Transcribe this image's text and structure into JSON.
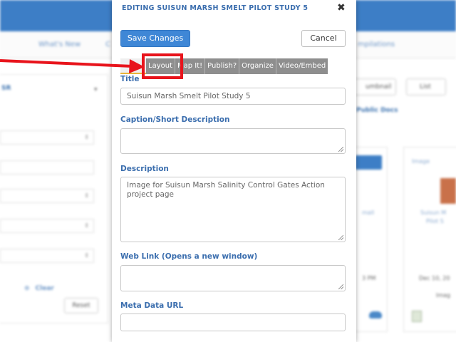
{
  "background": {
    "nav_items": [
      "What's New",
      "C",
      "mpilations"
    ],
    "left_panel_title": "SR",
    "clear_label": "Clear",
    "reset_label": "Reset",
    "view_buttons": [
      "umbnail",
      "List"
    ],
    "public_docs_label": "Public Docs",
    "card_items": [
      "Image",
      "Suisun M",
      "Pilot S",
      "Dec 10, 20",
      "Imag",
      "mall",
      "3 PM"
    ]
  },
  "modal": {
    "title": "EDITING SUISUN MARSH SMELT PILOT STUDY 5",
    "close_glyph": "✖",
    "save_label": "Save Changes",
    "cancel_label": "Cancel",
    "tabs": [
      "Layout",
      "Map It!",
      "Publish?",
      "Organize",
      "Video/Embed"
    ],
    "fields": {
      "title": {
        "label": "Title",
        "value": "Suisun Marsh Smelt Pilot Study 5"
      },
      "caption": {
        "label": "Caption/Short Description",
        "value": ""
      },
      "description": {
        "label": "Description",
        "value": "Image for Suisun Marsh Salinity Control Gates Action project page"
      },
      "web_link": {
        "label": "Web Link (Opens a new window)",
        "value": ""
      },
      "meta_data_url": {
        "label": "Meta Data URL",
        "value": ""
      }
    }
  },
  "annotation": {
    "color": "#e8141c"
  },
  "colors": {
    "accent": "#3f87d6",
    "heading": "#3b6eae",
    "tab_bg": "#8e8e8e"
  }
}
